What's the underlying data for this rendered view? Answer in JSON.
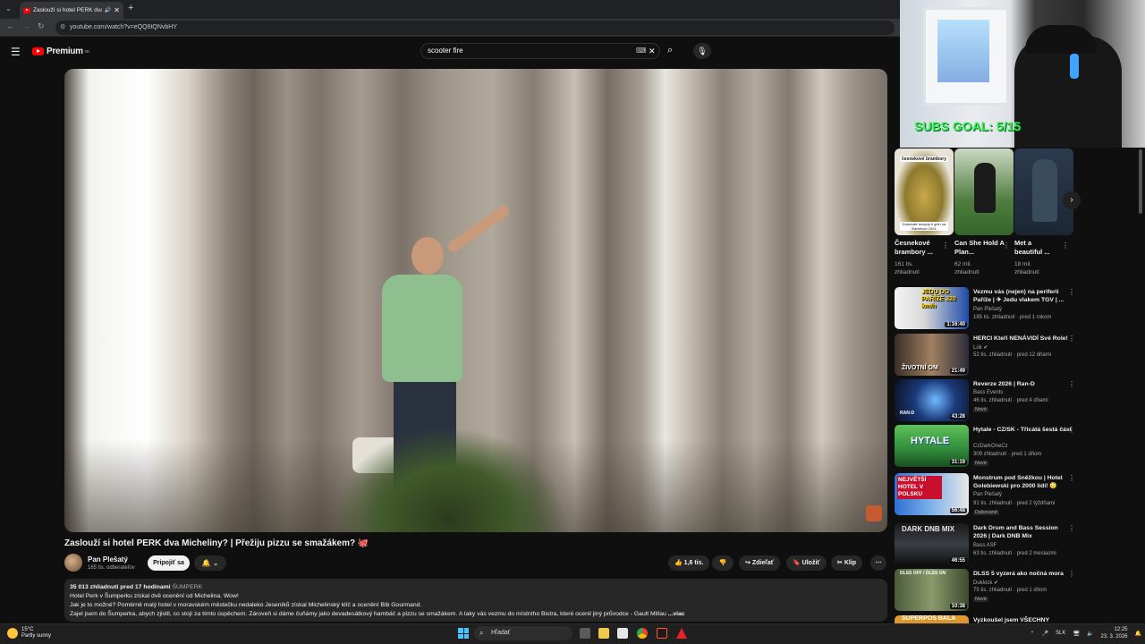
{
  "browser": {
    "tab_title": "Zaslouží si hotel PERK dva M",
    "url": "youtube.com/watch?v=eQQ6tQNvbHY"
  },
  "header": {
    "brand": "Premium",
    "brand_badge": "SK",
    "search_value": "scooter fire"
  },
  "video": {
    "title": "Zaslouží si hotel PERK dva Micheliny? | Přežiju pizzu se smažákem? 🐙",
    "channel": "Pan Plešatý",
    "subscribers": "165 tis. odberateľov",
    "join_label": "Pripojiť sa",
    "like_count": "1,6 tis.",
    "share_label": "Zdieľať",
    "save_label": "Uložiť",
    "clip_label": "Klip"
  },
  "description": {
    "stats": "35 013 zhliadnutí  pred 17 hodinami",
    "tag": "ŠUMPERK",
    "line1": "Hotel Perk v Šumperku získal dvě ocenění od Michelina. Wow!",
    "line2": "Jak je to možné? Poměrně malý hotel v moravském městečku nedaleko Jeseníků získal Michelinský klíč a ocenění Bib Gourmand.",
    "line3": "Zajel jsem do Šumperka, abych zjistil, co stojí za tímto úspěchem. Zároveň si dáme čuňámy jako devadesátkový hambáč a pizzu se smažákem. A taky vás vezmu do místního Bistra, které ocenil jiný průvodce - Gault Millau",
    "more_label": "...viac"
  },
  "overlay": {
    "subs_goal": "SUBS GOAL: 5/15"
  },
  "shorts": [
    {
      "title": "Česnekové brambory ...",
      "views": "161 tis. zhliadnutí",
      "thumb_text_top": "česnekové brambory",
      "thumb_text_bottom": "Dokonalé recepty k grilu na Barbecue 2024"
    },
    {
      "title": "Can She Hold A Plan...",
      "views": "62 mil. zhliadnutí"
    },
    {
      "title": "Met a beautiful ...",
      "views": "18 mil. zhliadnutí"
    }
  ],
  "recommendations": [
    {
      "title": "Vezmu vás (nejen) na periferii Paříže | ✈ Jedu vlakem TGV | ...",
      "channel": "Pan Plešatý",
      "meta": "185 tis. zhliadnutí · pred 1 rokom",
      "duration": "1:16:40",
      "badge": "",
      "thumb_text": "JEDU DO PAŘÍŽE 320 km/h"
    },
    {
      "title": "HERCI Kteří NENÁVIDÍ Své Role!",
      "channel": "Lúk",
      "meta": "52 tis. zhliadnutí · pred 12 dňami",
      "duration": "21:49",
      "badge": "",
      "thumb_text": "ŽIVOTNÍ OM"
    },
    {
      "title": "Reverze 2026 | Ran-D",
      "channel": "Bass Events",
      "meta": "46 tis. zhliadnutí · pred 4 dňami",
      "duration": "43:28",
      "badge": "Nové",
      "thumb_text": "RAN-D"
    },
    {
      "title": "Hytale - CZ/SK - Třicátá šestá část",
      "channel": "CzDarkOneCz",
      "meta": "309 zhliadnutí · pred 1 dňom",
      "duration": "31:19",
      "badge": "Nové",
      "thumb_text": "HYTALE"
    },
    {
      "title": "Monstrum pod Sněžkou | Hotel Golebiewski pro 2000 lidí! 😳",
      "channel": "Pan Plešatý",
      "meta": "91 tis. zhliadnutí · pred 2 týždňami",
      "duration": "56:48",
      "badge": "Dabované",
      "thumb_text": "NEJVĚTŠÍ HOTEL V POLSKU"
    },
    {
      "title": "Dark Drum and Bass Session 2026 | Dark DNB Mix",
      "channel": "Bass ASF",
      "meta": "63 tis. zhliadnutí · pred 2 mesiacmi",
      "duration": "46:55",
      "badge": "",
      "thumb_text": "DARK DNB MIX"
    },
    {
      "title": "DLSS 5 vyzerá ako nočná mora",
      "channel": "Duklock",
      "meta": "75 tis. zhliadnutí · pred 1 dňom",
      "duration": "10:38",
      "badge": "Nové",
      "thumb_text": "DLSS OFF / DLSS ON"
    },
    {
      "title": "Vyzkoušel jsem VŠECHNY",
      "channel": "",
      "meta": "",
      "duration": "",
      "badge": "",
      "thumb_text": "SUPERPOS BALA"
    }
  ],
  "taskbar": {
    "temp": "15°C",
    "weather": "Partly sunny",
    "search_placeholder": "Hľadať",
    "lang": "SLK",
    "time": "12:25",
    "date": "23. 3. 2026"
  },
  "colors": {
    "yt_red": "#ff0000",
    "subs_goal_green": "#3df04e",
    "background": "#0f0f0f"
  }
}
